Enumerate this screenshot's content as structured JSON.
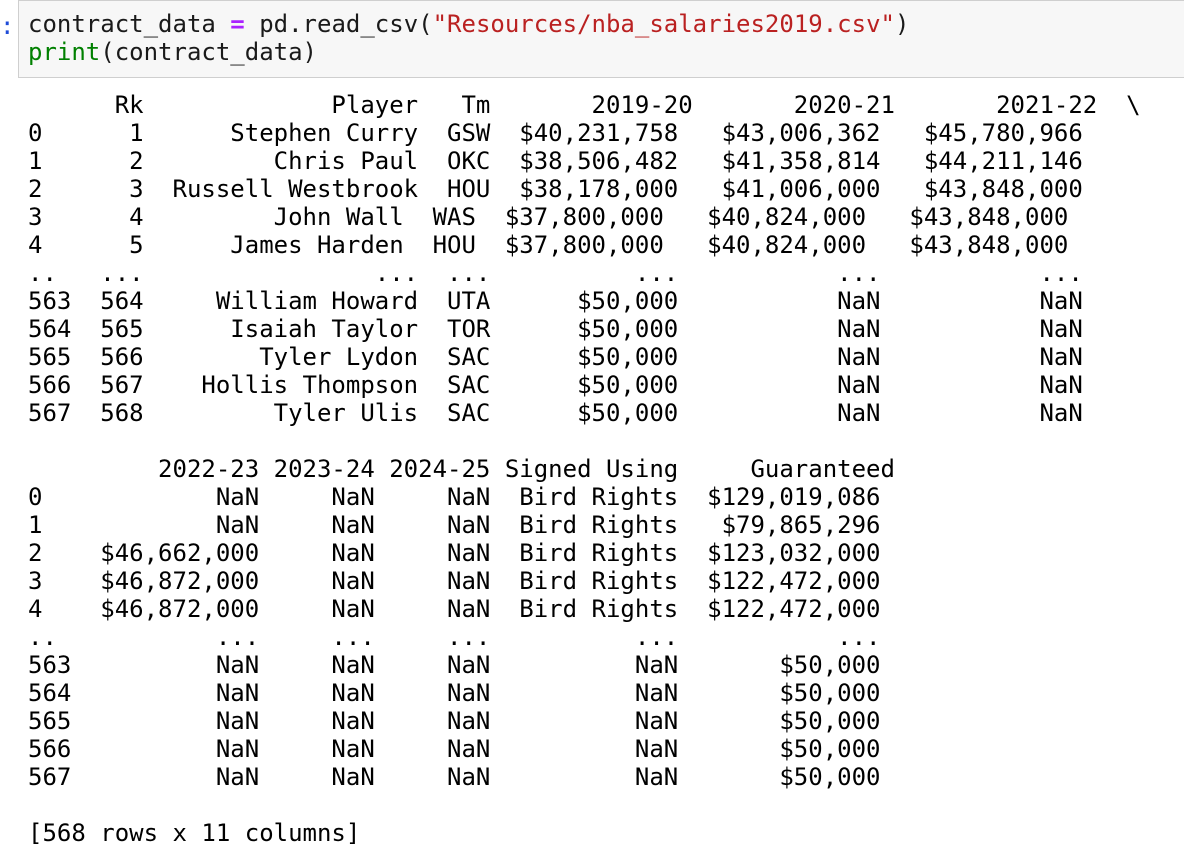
{
  "cell": {
    "prompt_marker": ":",
    "code": {
      "var": "contract_data",
      "assign": "=",
      "call_prefix": " pd.read_csv(",
      "path": "\"Resources/nba_salaries2019.csv\"",
      "call_suffix": ")",
      "print_fn": "print",
      "print_args": "(contract_data)"
    }
  },
  "output": {
    "lines": [
      "      Rk             Player   Tm       2019-20       2020-21       2021-22  \\",
      "0      1      Stephen Curry  GSW  $40,231,758   $43,006,362   $45,780,966",
      "1      2         Chris Paul  OKC  $38,506,482   $41,358,814   $44,211,146",
      "2      3  Russell Westbrook  HOU  $38,178,000   $41,006,000   $43,848,000",
      "3      4         John Wall  WAS  $37,800,000   $40,824,000   $43,848,000",
      "4      5      James Harden  HOU  $37,800,000   $40,824,000   $43,848,000",
      "..   ...                ...  ...          ...           ...           ...",
      "563  564     William Howard  UTA      $50,000           NaN           NaN",
      "564  565      Isaiah Taylor  TOR      $50,000           NaN           NaN",
      "565  566        Tyler Lydon  SAC      $50,000           NaN           NaN",
      "566  567    Hollis Thompson  SAC      $50,000           NaN           NaN",
      "567  568         Tyler Ulis  SAC      $50,000           NaN           NaN",
      "",
      "         2022-23 2023-24 2024-25 Signed Using     Guaranteed",
      "0            NaN     NaN     NaN  Bird Rights  $129,019,086",
      "1            NaN     NaN     NaN  Bird Rights   $79,865,296",
      "2    $46,662,000     NaN     NaN  Bird Rights  $123,032,000",
      "3    $46,872,000     NaN     NaN  Bird Rights  $122,472,000",
      "4    $46,872,000     NaN     NaN  Bird Rights  $122,472,000",
      "..           ...     ...     ...          ...           ...",
      "563          NaN     NaN     NaN          NaN       $50,000",
      "564          NaN     NaN     NaN          NaN       $50,000",
      "565          NaN     NaN     NaN          NaN       $50,000",
      "566          NaN     NaN     NaN          NaN       $50,000",
      "567          NaN     NaN     NaN          NaN       $50,000",
      "",
      "[568 rows x 11 columns]"
    ]
  }
}
